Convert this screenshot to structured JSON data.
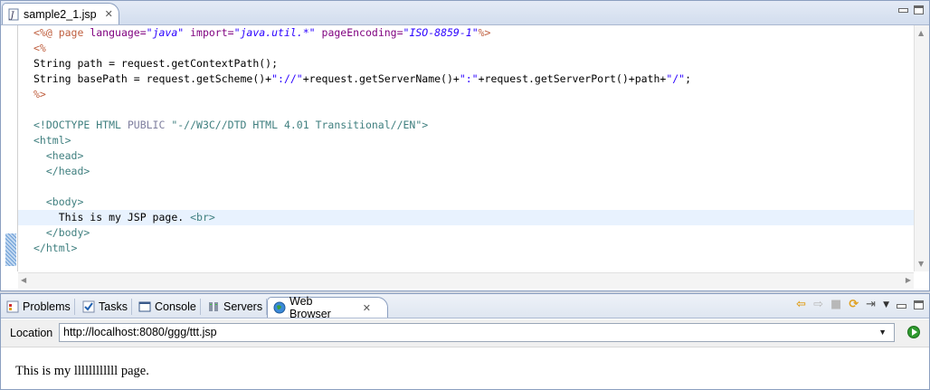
{
  "editor": {
    "tab_title": "sample2_1.jsp",
    "code_lines": [
      [
        {
          "t": "<%@ ",
          "c": "dir"
        },
        {
          "t": "page ",
          "c": "dir"
        },
        {
          "t": "language=",
          "c": "attr"
        },
        {
          "t": "\"java\"",
          "c": "val"
        },
        {
          "t": " import=",
          "c": "attr"
        },
        {
          "t": "\"java.util.*\"",
          "c": "val"
        },
        {
          "t": " pageEncoding=",
          "c": "attr"
        },
        {
          "t": "\"ISO-8859-1\"",
          "c": "val"
        },
        {
          "t": "%>",
          "c": "dir"
        }
      ],
      [
        {
          "t": "<%",
          "c": "dir"
        }
      ],
      [
        {
          "t": "String path = request.getContextPath();",
          "c": "plain"
        }
      ],
      [
        {
          "t": "String basePath = request.getScheme()+",
          "c": "plain"
        },
        {
          "t": "\"://\"",
          "c": "str"
        },
        {
          "t": "+request.getServerName()+",
          "c": "plain"
        },
        {
          "t": "\":\"",
          "c": "str"
        },
        {
          "t": "+request.getServerPort()+path+",
          "c": "plain"
        },
        {
          "t": "\"/\"",
          "c": "str"
        },
        {
          "t": ";",
          "c": "plain"
        }
      ],
      [
        {
          "t": "%>",
          "c": "dir"
        }
      ],
      [],
      [
        {
          "t": "<!DOCTYPE HTML ",
          "c": "doc"
        },
        {
          "t": "PUBLIC ",
          "c": "docq"
        },
        {
          "t": "\"-//W3C//DTD HTML 4.01 Transitional//EN\"",
          "c": "doc"
        },
        {
          "t": ">",
          "c": "doc"
        }
      ],
      [
        {
          "t": "<html>",
          "c": "tag"
        }
      ],
      [
        {
          "t": "  <head>",
          "c": "tag"
        }
      ],
      [
        {
          "t": "  </head>",
          "c": "tag"
        }
      ],
      [],
      [
        {
          "t": "  <body>",
          "c": "tag"
        }
      ],
      [
        {
          "t": "    This is my JSP page. ",
          "c": "plain"
        },
        {
          "t": "<br>",
          "c": "tag"
        }
      ],
      [
        {
          "t": "  </body>",
          "c": "tag"
        }
      ],
      [
        {
          "t": "</html>",
          "c": "tag"
        }
      ]
    ],
    "current_line": 12
  },
  "bottom": {
    "tabs": [
      {
        "label": "Problems",
        "icon": "problems-icon"
      },
      {
        "label": "Tasks",
        "icon": "tasks-icon"
      },
      {
        "label": "Console",
        "icon": "console-icon"
      },
      {
        "label": "Servers",
        "icon": "servers-icon"
      },
      {
        "label": "Web Browser",
        "icon": "globe-icon",
        "active": true
      }
    ],
    "location_label": "Location",
    "location_value": "http://localhost:8080/ggg/ttt.jsp",
    "page_text": "This is my llllllllllll page."
  }
}
